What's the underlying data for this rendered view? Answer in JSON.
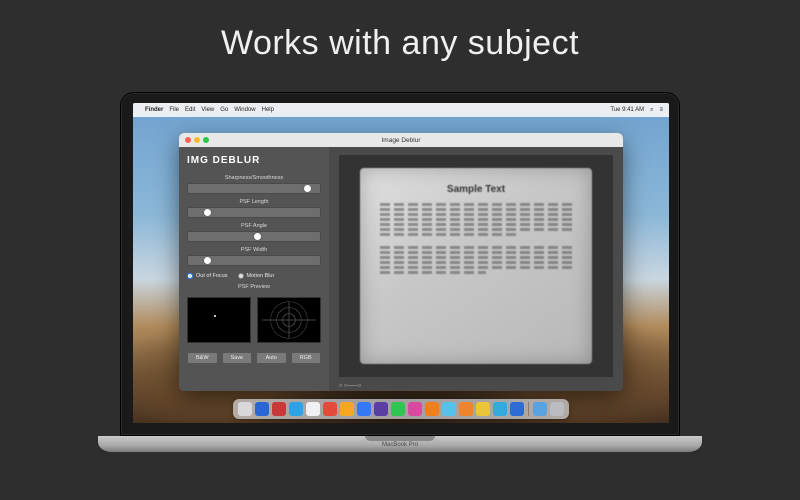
{
  "headline": "Works with any subject",
  "laptop_model": "MacBook Pro",
  "menubar": {
    "apple": "",
    "app": "Finder",
    "items": [
      "File",
      "Edit",
      "View",
      "Go",
      "Window",
      "Help"
    ],
    "clock": "Tue 9:41 AM",
    "battery_icon": "battery-icon",
    "search_icon": "search-icon",
    "menu_icon": "menu-icon"
  },
  "app": {
    "window_title": "Image Deblur",
    "title": "IMG DEBLUR",
    "sliders": [
      {
        "label": "Sharpness/Smoothness",
        "pos": 0.88
      },
      {
        "label": "PSF Length",
        "pos": 0.12
      },
      {
        "label": "PSF Angle",
        "pos": 0.5
      },
      {
        "label": "PSF Width",
        "pos": 0.12
      }
    ],
    "radios": {
      "out_of_focus": "Out of Focus",
      "motion_blur": "Motion Blur",
      "selected": "out_of_focus"
    },
    "psf_preview_label": "PSF Preview",
    "buttons": [
      "B&W",
      "Save",
      "Auto",
      "RGB"
    ],
    "sample_heading": "Sample Text",
    "zoom_indicator": "○ ○――○"
  },
  "dock_colors": [
    "#d9d9dd",
    "#2a66d4",
    "#c83a3a",
    "#2ea2e8",
    "#f0f0f2",
    "#e44a3c",
    "#f6a623",
    "#3478f6",
    "#5a3ea0",
    "#30c551",
    "#d84aa0",
    "#ef7f1a",
    "#54c2ea",
    "#ef842c",
    "#eac53a",
    "#34aadc",
    "#2d6bd6"
  ],
  "dock_trash": "#b9bcc0"
}
